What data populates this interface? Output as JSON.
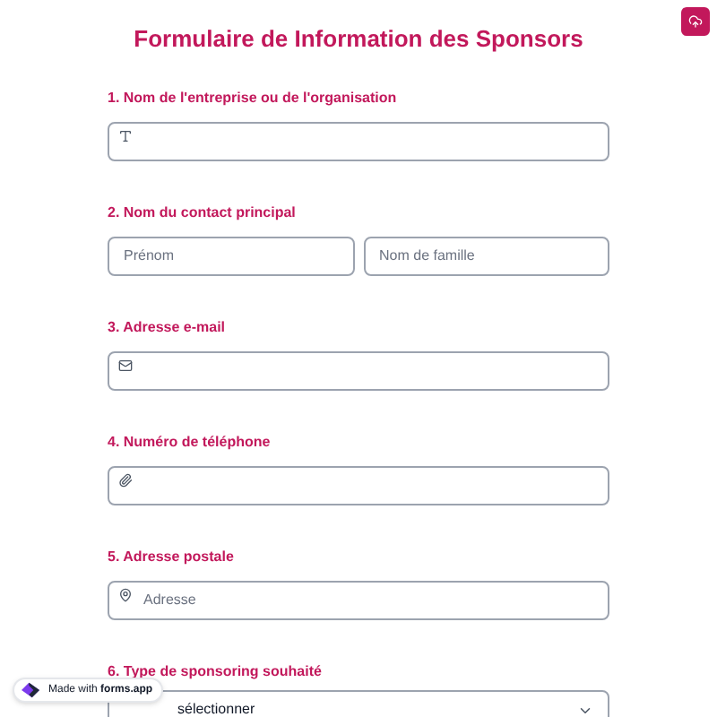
{
  "title": "Formulaire de Information des Sponsors",
  "questions": [
    {
      "label": "1. Nom de l'entreprise ou de l'organisation",
      "kind": "text",
      "fields": [
        {
          "kind": "text"
        }
      ]
    },
    {
      "label": "2. Nom du contact principal",
      "kind": "name",
      "fields": [
        {
          "placeholder": "Prénom"
        },
        {
          "placeholder": "Nom de famille"
        }
      ]
    },
    {
      "label": "3. Adresse e-mail",
      "kind": "text",
      "fields": [
        {
          "kind": "email"
        }
      ]
    },
    {
      "label": "4. Numéro de téléphone",
      "kind": "text",
      "fields": [
        {
          "kind": "phone"
        }
      ]
    },
    {
      "label": "5. Adresse postale",
      "kind": "text",
      "fields": [
        {
          "kind": "address",
          "placeholder": "Adresse"
        }
      ]
    },
    {
      "label": "6. Type de sponsoring souhaité",
      "kind": "select",
      "fields": [
        {
          "placeholder": "sélectionner"
        }
      ]
    }
  ],
  "badge": {
    "prefix": "Made with",
    "brand": "forms.app"
  }
}
